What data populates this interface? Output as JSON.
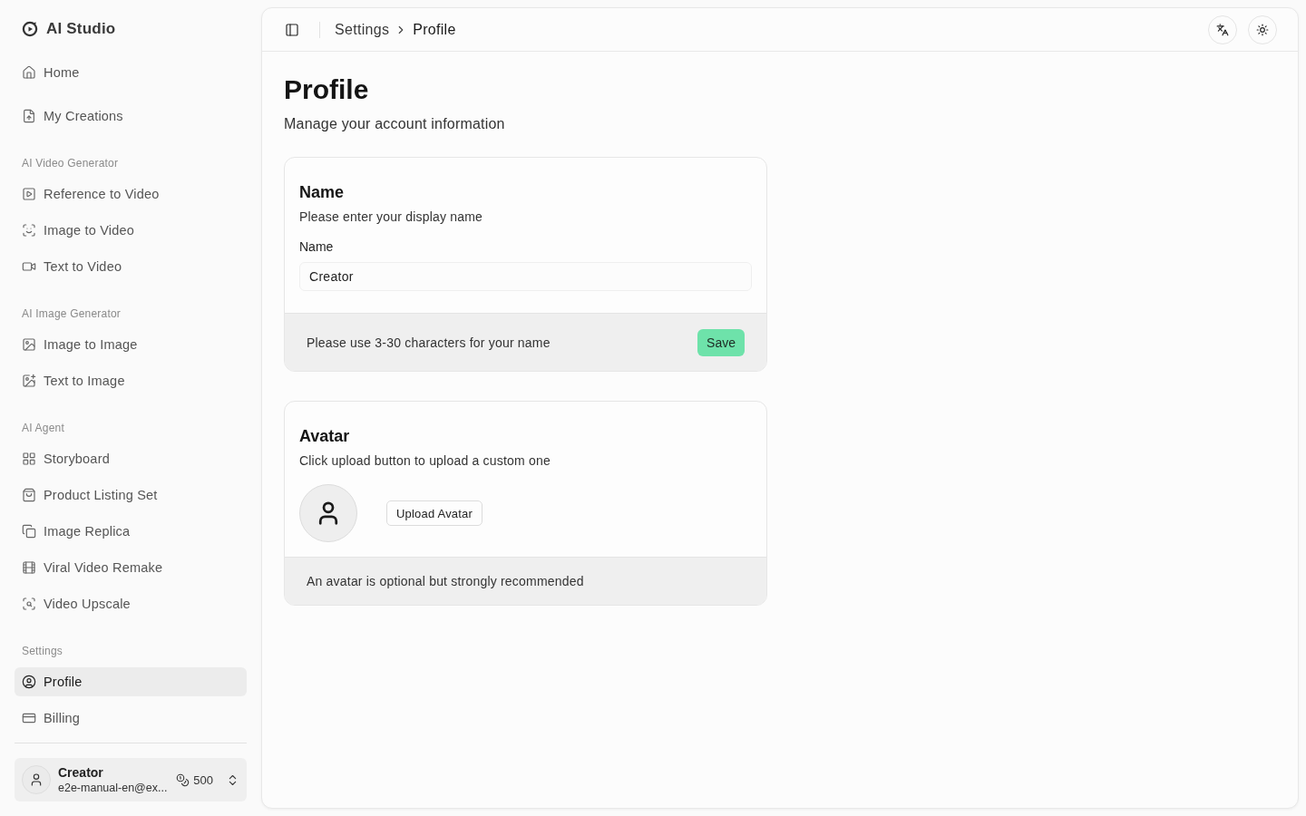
{
  "sidebar": {
    "brand": "AI Studio",
    "sections": [
      {
        "items": [
          {
            "label": "Home",
            "selected": false
          },
          {
            "label": "My Creations",
            "selected": false
          }
        ]
      },
      {
        "title": "AI Video Generator",
        "items": [
          {
            "label": "Reference to Video",
            "selected": false
          },
          {
            "label": "Image to Video",
            "selected": false
          },
          {
            "label": "Text to Video",
            "selected": false
          }
        ]
      },
      {
        "title": "AI Image Generator",
        "items": [
          {
            "label": "Image to Image",
            "selected": false
          },
          {
            "label": "Text to Image",
            "selected": false
          }
        ]
      },
      {
        "title": "AI Agent",
        "items": [
          {
            "label": "Storyboard",
            "selected": false
          },
          {
            "label": "Product Listing Set",
            "selected": false
          },
          {
            "label": "Image Replica",
            "selected": false
          },
          {
            "label": "Viral Video Remake",
            "selected": false
          },
          {
            "label": "Video Upscale",
            "selected": false
          }
        ]
      },
      {
        "title": "Settings",
        "items": [
          {
            "label": "Profile",
            "selected": true
          },
          {
            "label": "Billing",
            "selected": false
          }
        ]
      }
    ],
    "account": {
      "name": "Creator",
      "email": "e2e-manual-en@ex...",
      "credits": "500"
    }
  },
  "header": {
    "breadcrumb": [
      "Settings",
      "Profile"
    ]
  },
  "page": {
    "title": "Profile",
    "subtitle": "Manage your account information"
  },
  "name_card": {
    "title": "Name",
    "description": "Please enter your display name",
    "field_label": "Name",
    "field_value": "Creator",
    "hint": "Please use 3-30 characters for your name",
    "button": "Save"
  },
  "avatar_card": {
    "title": "Avatar",
    "description": "Click upload button to upload a custom one",
    "button": "Upload Avatar",
    "footer": "An avatar is optional but strongly recommended"
  }
}
